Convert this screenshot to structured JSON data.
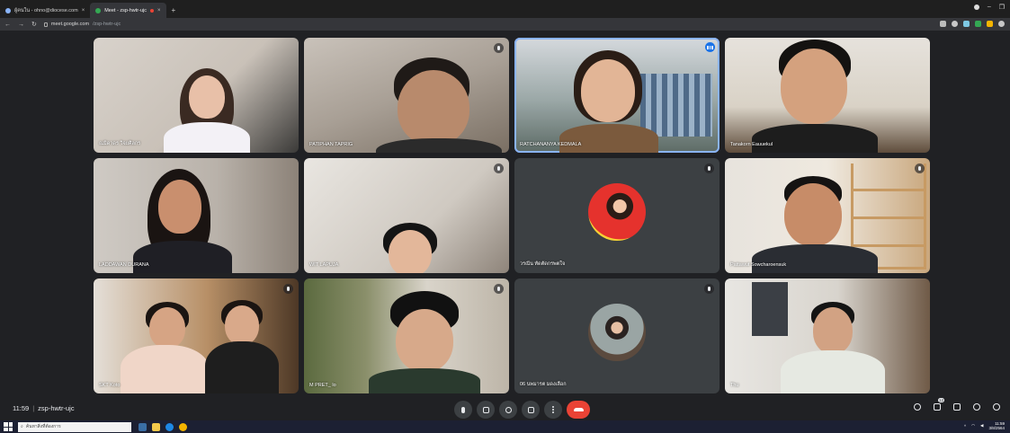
{
  "browser": {
    "tabs": [
      {
        "label": "ผู้คนใน - ohno@diocese.com",
        "icon": "mail-icon",
        "active": false
      },
      {
        "label": "Meet - zsp-hwtr-ujc",
        "icon": "meet-icon",
        "active": true
      }
    ],
    "new_tab_label": "+",
    "url": {
      "host": "meet.google.com",
      "path": "/zsp-hwtr-ujc"
    }
  },
  "participants": [
    {
      "name": "ณมิดาดร วิจยศิลกร"
    },
    {
      "name": "PATIPHAN TAPRIG"
    },
    {
      "name": "RATCHANANYA KEDMALA"
    },
    {
      "name": "Tanakorn Eauuekul"
    },
    {
      "name": "LADDAWAN DURANA"
    },
    {
      "name": "WIT LAPUJA"
    },
    {
      "name": "วรณีน ทัดตัดกรพตใจ"
    },
    {
      "name": "Pattawut Sowcharoensuk"
    },
    {
      "name": "SKT Koto"
    },
    {
      "name": "M PRET_ lo"
    },
    {
      "name": "06 นพมารต มดงเลือก"
    },
    {
      "name": "Thu"
    }
  ],
  "meeting": {
    "time": "11:59",
    "separator": "|",
    "code": "zsp-hwtr-ujc"
  },
  "controls": {
    "people_count": "12"
  },
  "taskbar": {
    "search_placeholder": "ค้นหาสิ่งที่ต้องการ",
    "tray_time": "11:59",
    "tray_date": "3/8/2564"
  }
}
